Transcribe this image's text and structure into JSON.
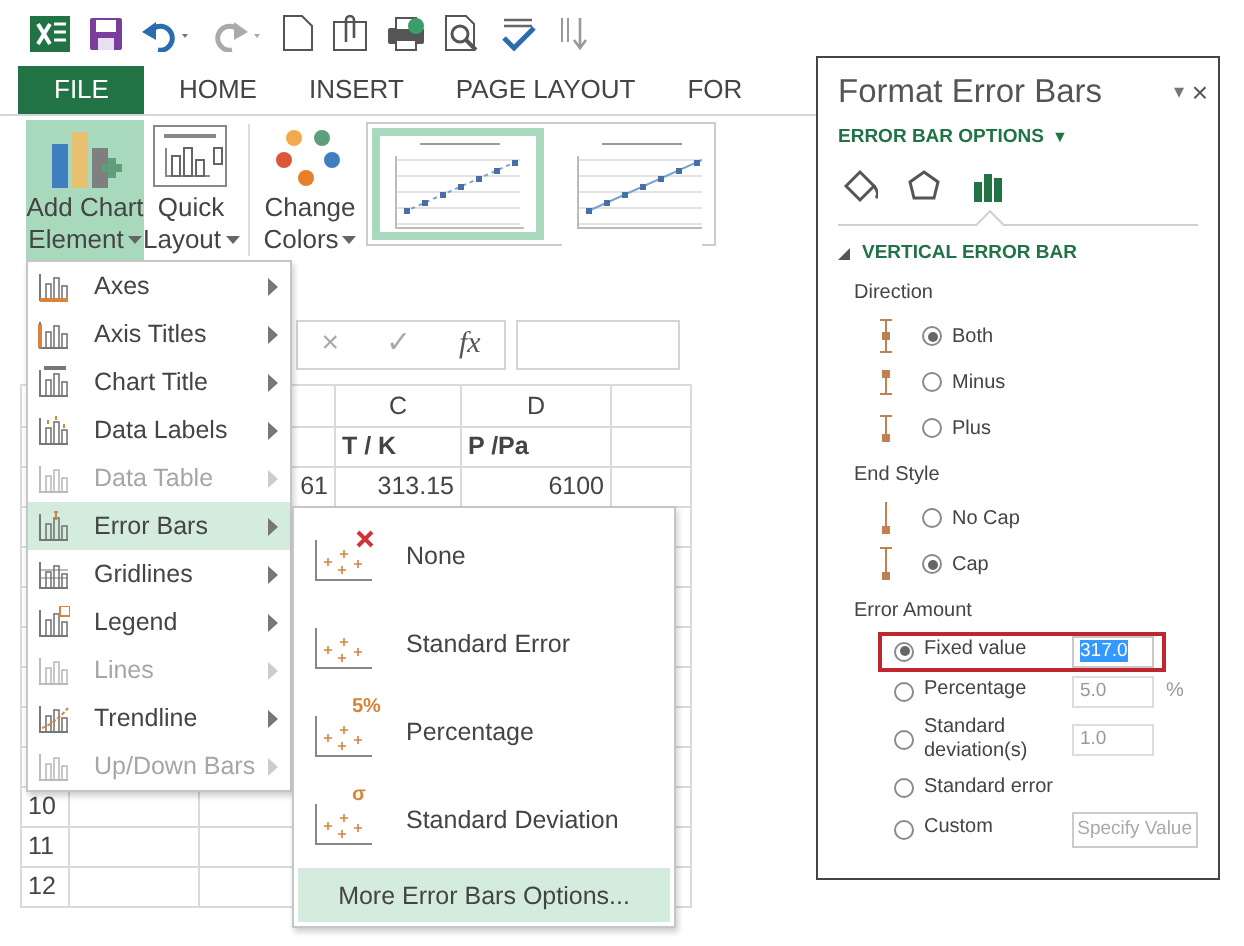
{
  "ribbon_tabs": [
    {
      "label": "FILE",
      "kind": "file"
    },
    {
      "label": "HOME",
      "kind": "tab"
    },
    {
      "label": "INSERT",
      "kind": "tab"
    },
    {
      "label": "PAGE LAYOUT",
      "kind": "tab"
    },
    {
      "label": "FOR",
      "kind": "tab"
    }
  ],
  "ribbon_buttons": [
    {
      "label": [
        "Add Chart",
        "Element"
      ],
      "kind": "add_element",
      "selected": true
    },
    {
      "label": [
        "Quick",
        "Layout"
      ],
      "kind": "quick_layout",
      "selected": false
    },
    {
      "label": [
        "Change",
        "Colors"
      ],
      "kind": "change_colors",
      "selected": false
    }
  ],
  "chart_styles": [
    {
      "selected": true
    },
    {
      "selected": false
    }
  ],
  "formula_bar": {
    "cancel": "×",
    "enter": "✓",
    "function": "fx"
  },
  "sheet": {
    "column_headers": [
      "C",
      "D"
    ],
    "rows": [
      {
        "bold": true,
        "cells": [
          "T / K",
          "P /Pa"
        ]
      },
      {
        "bold": false,
        "column_b": "61",
        "cells": [
          "313.15",
          "6100"
        ]
      }
    ],
    "row_numbers": [
      "10",
      "11",
      "12"
    ]
  },
  "chart_element_menu": [
    {
      "label": "Axes",
      "disabled": false,
      "selected": false
    },
    {
      "label": "Axis Titles",
      "disabled": false,
      "selected": false
    },
    {
      "label": "Chart Title",
      "disabled": false,
      "selected": false
    },
    {
      "label": "Data Labels",
      "disabled": false,
      "selected": false
    },
    {
      "label": "Data Table",
      "disabled": true,
      "selected": false
    },
    {
      "label": "Error Bars",
      "disabled": false,
      "selected": true
    },
    {
      "label": "Gridlines",
      "disabled": false,
      "selected": false
    },
    {
      "label": "Legend",
      "disabled": false,
      "selected": false
    },
    {
      "label": "Lines",
      "disabled": true,
      "selected": false
    },
    {
      "label": "Trendline",
      "disabled": false,
      "selected": false
    },
    {
      "label": "Up/Down Bars",
      "disabled": true,
      "selected": false
    }
  ],
  "error_bars_submenu": [
    {
      "label": "None",
      "kind": "none",
      "selected": false
    },
    {
      "label": "Standard Error",
      "kind": "standard_error",
      "selected": false
    },
    {
      "label": "Percentage",
      "kind": "percentage",
      "icon_label": "5%",
      "selected": false
    },
    {
      "label": "Standard Deviation",
      "kind": "standard_deviation",
      "icon_label": "σ",
      "selected": false
    },
    {
      "label": "More Error Bars Options...",
      "kind": "more",
      "selected": true
    }
  ],
  "format_panel": {
    "title": "Format Error Bars",
    "pin": "▾",
    "close": "×",
    "options_header": "ERROR BAR OPTIONS",
    "options_caret": "▼",
    "tabs": [
      {
        "selected": false
      },
      {
        "selected": false
      },
      {
        "selected": true
      }
    ],
    "section": {
      "title": "VERTICAL ERROR BAR",
      "expanded": true,
      "groups": [
        {
          "title": "Direction",
          "options": [
            {
              "label": "Both",
              "kind": "both",
              "selected": true
            },
            {
              "label": "Minus",
              "kind": "minus",
              "selected": false
            },
            {
              "label": "Plus",
              "kind": "plus",
              "selected": false
            }
          ]
        },
        {
          "title": "End Style",
          "options": [
            {
              "label": "No Cap",
              "kind": "no_cap",
              "selected": false
            },
            {
              "label": "Cap",
              "kind": "cap",
              "selected": true
            }
          ]
        }
      ],
      "error_amount": {
        "title": "Error Amount",
        "options": [
          {
            "label": "Fixed value",
            "selected": true,
            "highlighted": true,
            "value": "317.0",
            "value_selected": true,
            "disabled": false
          },
          {
            "label": "Percentage",
            "selected": false,
            "highlighted": false,
            "value": "5.0",
            "unit": "%",
            "value_selected": false,
            "disabled": true
          },
          {
            "label": "Standard deviation(s)",
            "selected": false,
            "highlighted": false,
            "value": "1.0",
            "value_selected": false,
            "disabled": true
          },
          {
            "label": "Standard error",
            "selected": false,
            "highlighted": false
          },
          {
            "label": "Custom",
            "selected": false,
            "highlighted": false,
            "button": "Specify Value",
            "disabled": true
          }
        ]
      }
    }
  }
}
